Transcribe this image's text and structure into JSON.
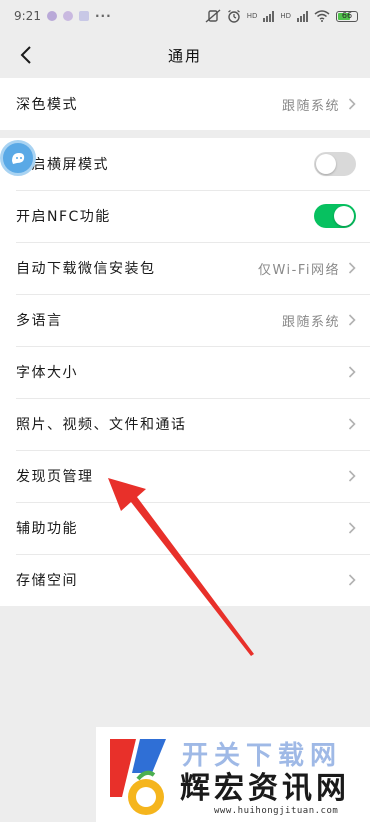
{
  "status_bar": {
    "time": "9:21",
    "more": "···",
    "signal_label_1": "HD",
    "signal_label_2": "HD",
    "battery": "66"
  },
  "nav": {
    "title": "通用"
  },
  "group1": {
    "dark_mode_label": "深色模式",
    "dark_mode_value": "跟随系统"
  },
  "group2": {
    "landscape_label": "开启横屏模式",
    "landscape_on": false,
    "nfc_label": "开启NFC功能",
    "nfc_on": true,
    "auto_download_label": "自动下载微信安装包",
    "auto_download_value": "仅Wi-Fi网络",
    "language_label": "多语言",
    "language_value": "跟随系统",
    "font_size_label": "字体大小",
    "media_label": "照片、视频、文件和通话",
    "discover_label": "发现页管理",
    "assist_label": "辅助功能",
    "storage_label": "存储空间"
  },
  "watermark": {
    "text_top": "开关下载网",
    "text": "辉宏资讯网",
    "url": "www.huihongjituan.com"
  },
  "colors": {
    "accent_green": "#07c160",
    "arrow_red": "#e8302a",
    "background": "#ededed"
  }
}
